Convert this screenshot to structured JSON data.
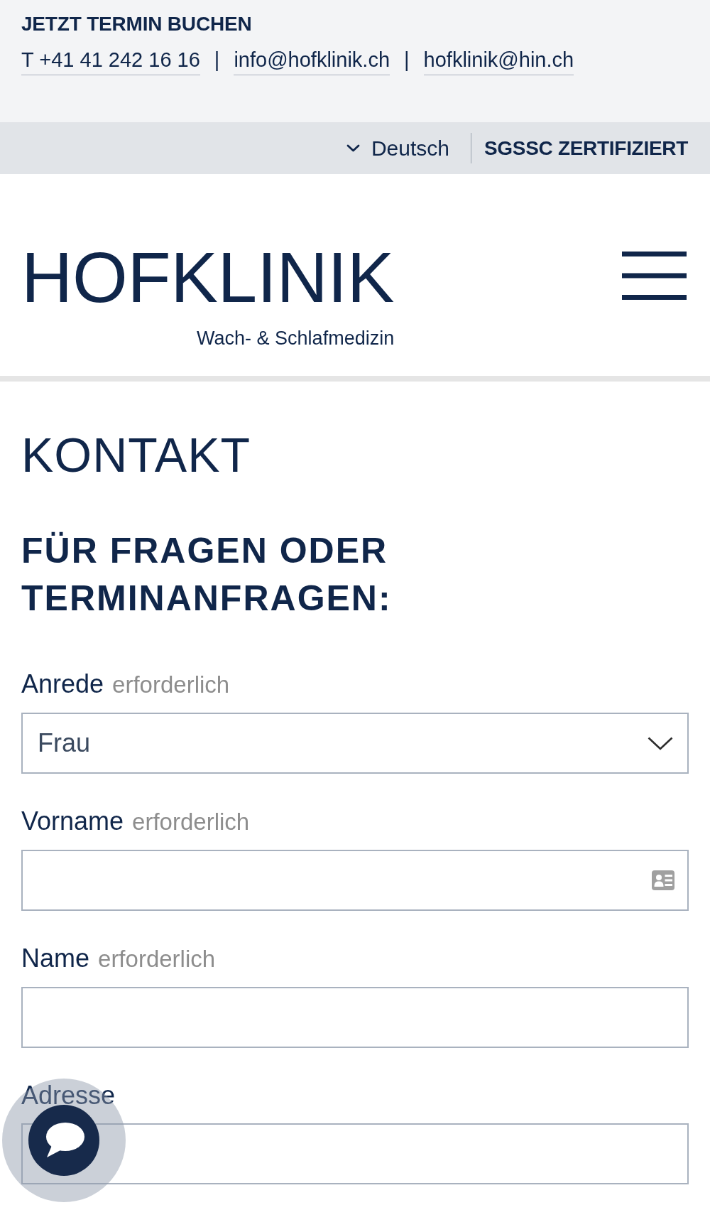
{
  "top_bar": {
    "booking_link": "JETZT TERMIN BUCHEN",
    "contacts": [
      {
        "kind": "link",
        "text": "T +41 41 242 16 16"
      },
      {
        "kind": "separator",
        "text": "|"
      },
      {
        "kind": "link",
        "text": "info@hofklinik.ch"
      },
      {
        "kind": "separator",
        "text": "|"
      },
      {
        "kind": "link",
        "text": "hofklinik@hin.ch"
      }
    ]
  },
  "utility_bar": {
    "language": "Deutsch",
    "certification": "SGSSC ZERTIFIZIERT"
  },
  "header": {
    "logo": "HOFKLINIK",
    "tagline": "Wach- & Schlafmedizin"
  },
  "page": {
    "title": "KONTAKT",
    "subtitle": "FÜR FRAGEN ODER TERMINANFRAGEN:"
  },
  "form": {
    "fields": [
      {
        "kind": "select",
        "label": "Anrede",
        "note": "erforderlich",
        "value": "Frau"
      },
      {
        "kind": "text",
        "label": "Vorname",
        "note": "erforderlich",
        "autofill_icon": true
      },
      {
        "kind": "text",
        "label": "Name",
        "note": "erforderlich",
        "autofill_icon": false
      },
      {
        "kind": "text",
        "label": "Adresse",
        "autofill_icon": false
      }
    ]
  }
}
